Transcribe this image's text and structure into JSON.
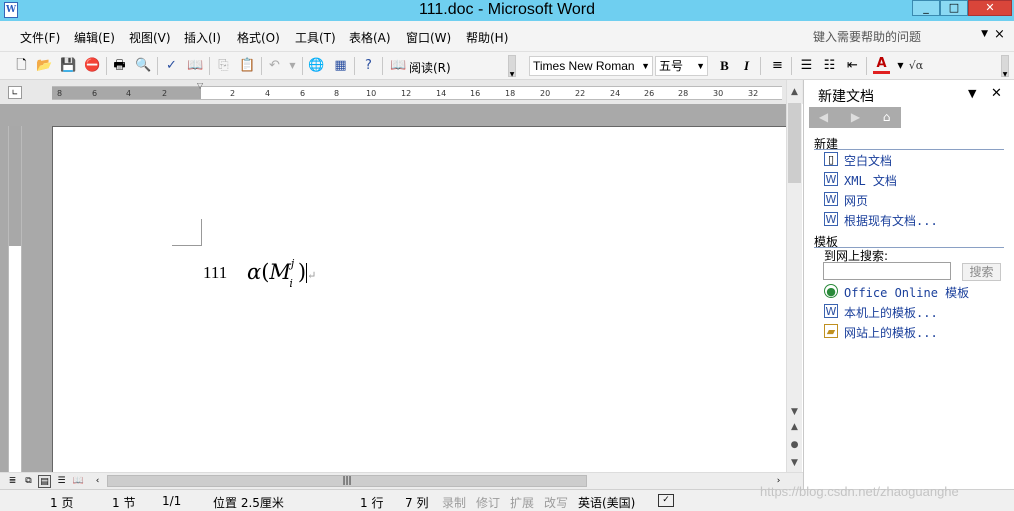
{
  "window": {
    "title": "111.doc - Microsoft Word",
    "app_icon": "W",
    "controls": {
      "minimize": "_",
      "maximize": "□",
      "close": "✕"
    }
  },
  "menu": {
    "items": [
      "文件(F)",
      "编辑(E)",
      "视图(V)",
      "插入(I)",
      "格式(O)",
      "工具(T)",
      "表格(A)",
      "窗口(W)",
      "帮助(H)"
    ],
    "help_placeholder": "键入需要帮助的问题",
    "close": "×"
  },
  "toolbar": {
    "read_label": "阅读(R)",
    "font_name": "Times New Roman",
    "font_size": "五号",
    "bold": "B",
    "italic": "I",
    "font_color": "A",
    "formula": "√α"
  },
  "document": {
    "text": "111",
    "formula": {
      "alpha": "α",
      "open": "(",
      "M": "M",
      "sup": "j",
      "sub": "i",
      "close": ")",
      "para_mark": "↵"
    }
  },
  "status": {
    "page": "1 页",
    "section": "1 节",
    "page_of": "1/1",
    "position": "位置 2.5厘米",
    "line": "1 行",
    "column": "7 列",
    "rec": "录制",
    "trk": "修订",
    "ext": "扩展",
    "ovr": "改写",
    "language": "英语(美国)"
  },
  "watermark": "https://blog.csdn.net/zhaoguanghe",
  "taskpane": {
    "title": "新建文档",
    "new_section": "新建",
    "new_items": [
      "空白文档",
      "XML 文档",
      "网页",
      "根据现有文档..."
    ],
    "templates_section": "模板",
    "search_label": "到网上搜索:",
    "search_button": "搜索",
    "template_items": [
      "Office Online 模板",
      "本机上的模板...",
      "网站上的模板..."
    ]
  },
  "colors": {
    "titlebar": "#6fcff0",
    "link": "#1a3f9b",
    "font_color_bar": "#e02020"
  }
}
